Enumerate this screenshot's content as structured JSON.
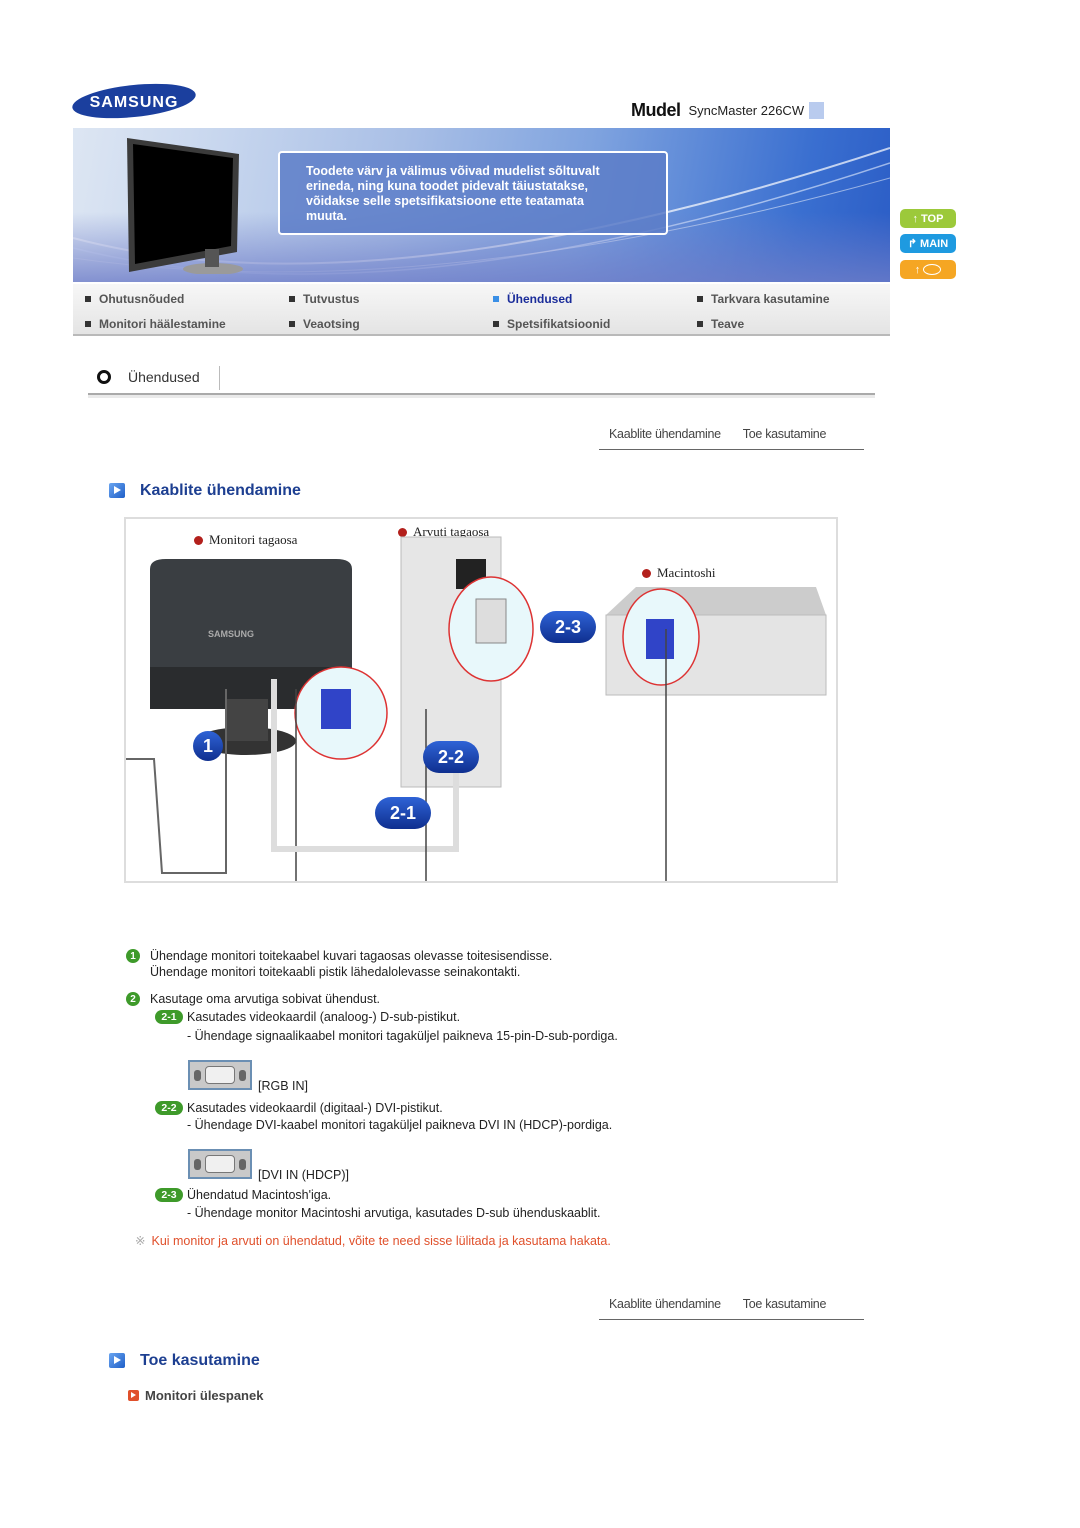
{
  "header": {
    "brand": "SAMSUNG",
    "model_label": "Mudel",
    "model_value": "SyncMaster 226CW"
  },
  "banner": {
    "notice": [
      "Toodete värv ja välimus võivad mudelist sõltuvalt",
      "erineda, ning kuna toodet pidevalt täiustatakse,",
      "võidakse selle spetsifikatsioone ette teatamata",
      "muuta."
    ]
  },
  "side_buttons": [
    {
      "label": "TOP",
      "icon": "arrow-up-icon"
    },
    {
      "label": "MAIN",
      "icon": "arrow-turn-icon"
    },
    {
      "label": "",
      "icon": "language-icon"
    }
  ],
  "nav": [
    {
      "label": "Ohutusnõuded",
      "active": false
    },
    {
      "label": "Tutvustus",
      "active": false
    },
    {
      "label": "Ühendused",
      "active": true
    },
    {
      "label": "Tarkvara kasutamine",
      "active": false
    },
    {
      "label": "Monitori häälestamine",
      "active": false
    },
    {
      "label": "Veaotsing",
      "active": false
    },
    {
      "label": "Spetsifikatsioonid",
      "active": false
    },
    {
      "label": "Teave",
      "active": false
    }
  ],
  "section": {
    "title": "Ühendused"
  },
  "subnav": {
    "items": [
      "Kaablite ühendamine",
      "Toe kasutamine"
    ]
  },
  "heading1": "Kaablite ühendamine",
  "diagram": {
    "labels": {
      "monitor_back": "Monitori tagaosa",
      "pc_back": "Arvuti tagaosa",
      "mac": "Macintoshi"
    },
    "badges": [
      "1",
      "2-1",
      "2-2",
      "2-3"
    ],
    "monitor_brand": "SAMSUNG"
  },
  "instructions": {
    "step1_num": "1",
    "step1": [
      "Ühendage monitori toitekaabel kuvari tagaosas olevasse toitesisendisse.",
      "Ühendage monitori toitekaabli pistik lähedalolevasse seinakontakti."
    ],
    "step2_num": "2",
    "step2": "Kasutage oma arvutiga sobivat ühendust.",
    "sub": [
      {
        "num": "2-1",
        "title": "Kasutades videokaardil (analoog-) D-sub-pistikut.",
        "detail": "- Ühendage signaalikaabel monitori tagaküljel paikneva 15-pin-D-sub-pordiga.",
        "port": "[RGB IN]"
      },
      {
        "num": "2-2",
        "title": "Kasutades videokaardil (digitaal-) DVI-pistikut.",
        "detail": "- Ühendage DVI-kaabel monitori tagaküljel paikneva DVI IN (HDCP)-pordiga.",
        "port": "[DVI IN (HDCP)]"
      },
      {
        "num": "2-3",
        "title": "Ühendatud Macintosh'iga.",
        "detail": "- Ühendage monitor Macintoshi arvutiga, kasutades D-sub ühenduskaablit."
      }
    ],
    "warning_mark": "※",
    "warning": "Kui monitor ja arvuti on ühendatud, võite te need sisse lülitada ja kasutama hakata."
  },
  "heading2": "Toe kasutamine",
  "subheading": "Monitori ülespanek"
}
